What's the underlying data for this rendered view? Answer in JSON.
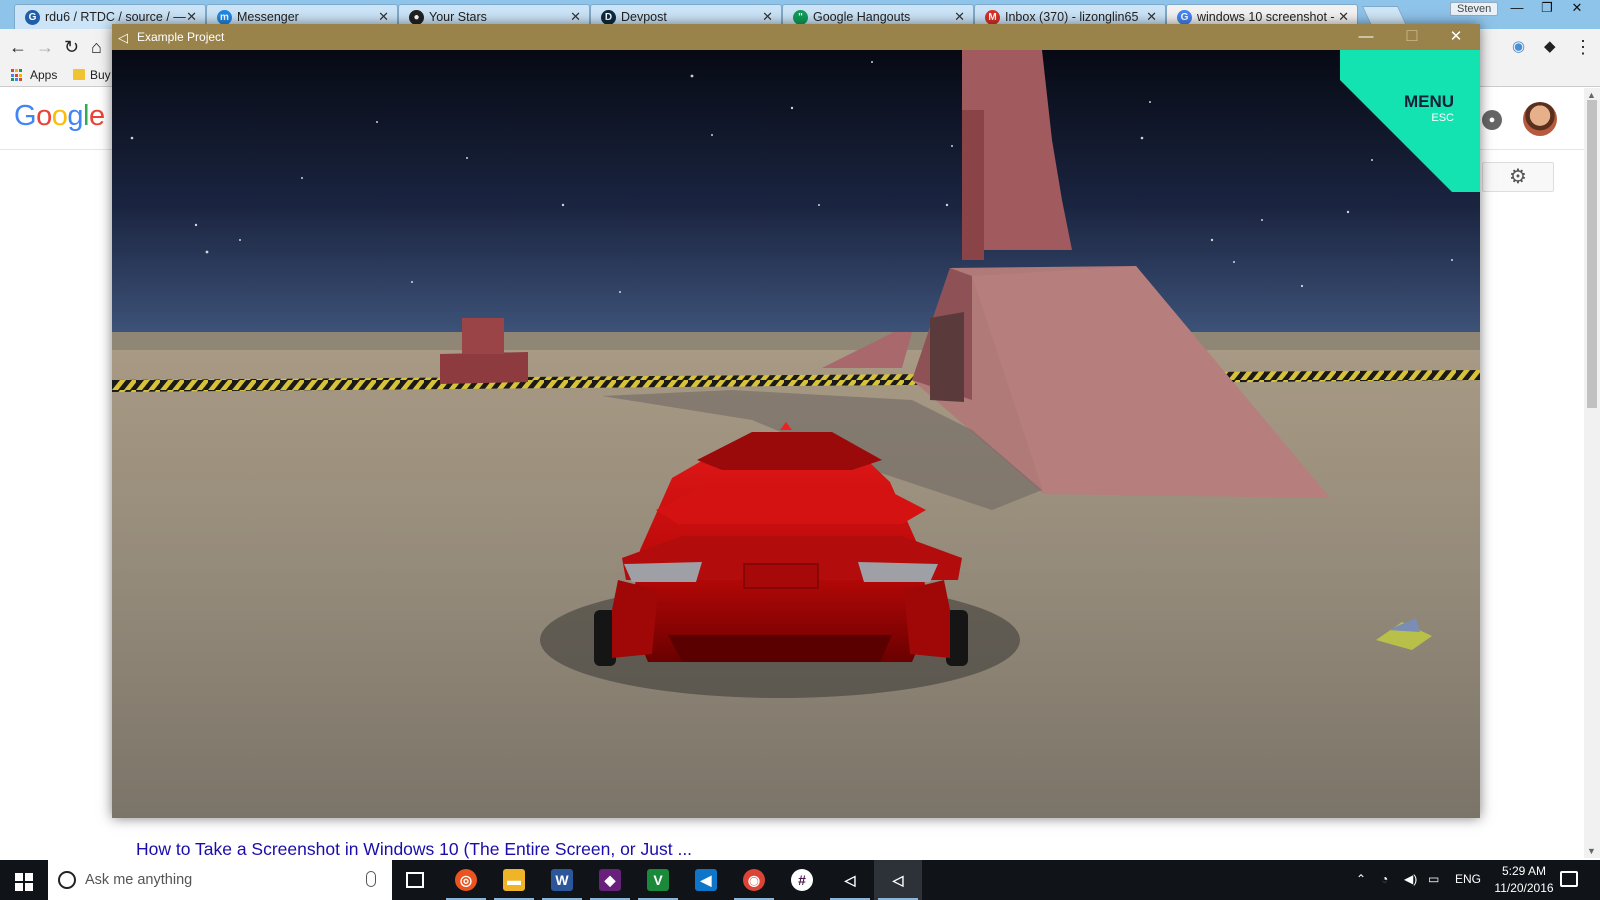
{
  "browser": {
    "tabs": [
      {
        "title": "rdu6 / RTDC / source / —",
        "favicon": "git-icon",
        "fav_color": "#1f5fa8",
        "fav_glyph": "G"
      },
      {
        "title": "Messenger",
        "favicon": "messenger-icon",
        "fav_color": "#1e88e5",
        "fav_glyph": "m"
      },
      {
        "title": "Your Stars",
        "favicon": "github-icon",
        "fav_color": "#222222",
        "fav_glyph": "●"
      },
      {
        "title": "Devpost",
        "favicon": "devpost-icon",
        "fav_color": "#0d2b3e",
        "fav_glyph": "D"
      },
      {
        "title": "Google Hangouts",
        "favicon": "hangouts-icon",
        "fav_color": "#0f9d58",
        "fav_glyph": "\""
      },
      {
        "title": "Inbox (370) - lizonglin65",
        "favicon": "gmail-icon",
        "fav_color": "#d93025",
        "fav_glyph": "M"
      },
      {
        "title": "windows 10 screenshot -",
        "favicon": "google-icon",
        "fav_color": "#4285f4",
        "fav_glyph": "G"
      }
    ],
    "profile_name": "Steven",
    "bookmarks": {
      "apps_label": "Apps",
      "buy_label": "Buy"
    },
    "google_logo": "Google",
    "result_link_text": "How to Take a Screenshot in Windows 10 (The Entire Screen, or Just ..."
  },
  "game_window": {
    "title": "Example Project",
    "menu_label": "MENU",
    "esc_label": "ESC",
    "colors": {
      "menu_corner": "#12e3b0",
      "titlebar": "#9a834b",
      "car": "#c40c0c"
    }
  },
  "taskbar": {
    "search_placeholder": "Ask me anything",
    "apps": [
      {
        "name": "ubuntu",
        "glyph": "◎",
        "color": "#e95420"
      },
      {
        "name": "file-explorer",
        "glyph": "▬",
        "color": "#f0b429"
      },
      {
        "name": "word",
        "glyph": "W",
        "color": "#2b579a"
      },
      {
        "name": "visual-studio",
        "glyph": "◆",
        "color": "#68217a"
      },
      {
        "name": "vim",
        "glyph": "V",
        "color": "#1a8a3a"
      },
      {
        "name": "vscode",
        "glyph": "◀",
        "color": "#0e75c8"
      },
      {
        "name": "chrome",
        "glyph": "◉",
        "color": "#db4437"
      },
      {
        "name": "slack",
        "glyph": "#",
        "color": "#4a154b"
      },
      {
        "name": "unity",
        "glyph": "◁",
        "color": "#222222"
      },
      {
        "name": "unity-game",
        "glyph": "◁",
        "color": "#222222"
      }
    ],
    "language": "ENG",
    "time": "5:29 AM",
    "date": "11/20/2016"
  }
}
